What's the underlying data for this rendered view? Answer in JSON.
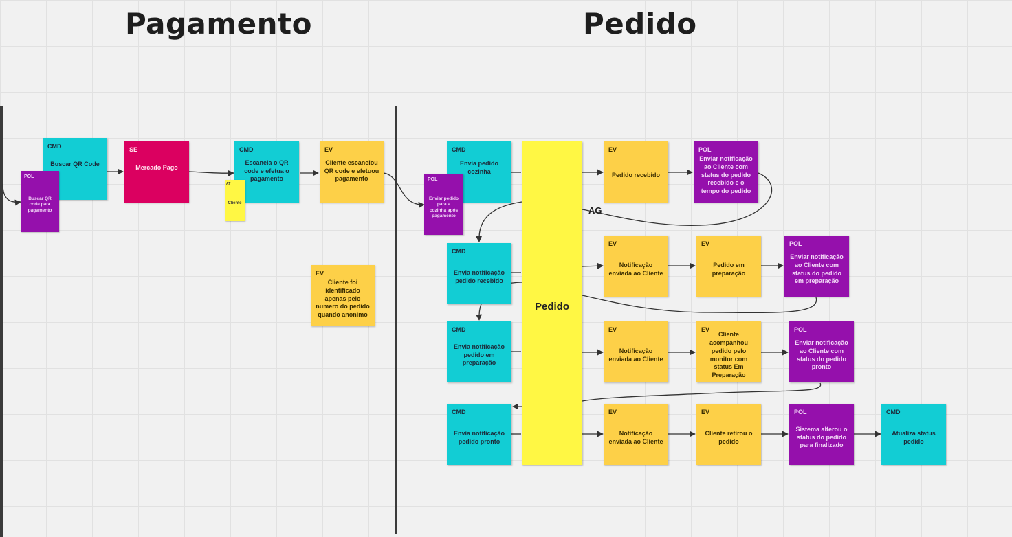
{
  "titles": {
    "left": "Pagamento",
    "right": "Pedido"
  },
  "colors": {
    "cmd": "#12cdd4",
    "ev": "#fdd048",
    "pol": "#9510ac",
    "se": "#db0060",
    "aggregate": "#fff744"
  },
  "aggregate_label": "AG",
  "stickies": {
    "cmd_buscar": {
      "tag": "CMD",
      "text": "Buscar QR Code"
    },
    "pol_buscar": {
      "tag": "POL",
      "text": "Buscar QR code para pagamento"
    },
    "se_mercado": {
      "tag": "SE",
      "text": "Mercado Pago"
    },
    "cmd_escaneia": {
      "tag": "CMD",
      "text": "Escaneia o QR code e efetua o pagamento"
    },
    "at_cliente": {
      "tag": "AT",
      "text": "Cliente"
    },
    "ev_escaneou": {
      "tag": "EV",
      "text": "Cliente escaneiou QR code e efetuou pagamento"
    },
    "ev_identificado": {
      "tag": "EV",
      "text": "Cliente foi identificado apenas pelo numero do pedido quando anonimo"
    },
    "cmd_envia_cozinha": {
      "tag": "CMD",
      "text": "Envia pedido cozinha"
    },
    "pol_enviar_cozinha": {
      "tag": "POL",
      "text": "Enviar pedido para a cozinha após pagamento"
    },
    "agg_pedido": {
      "text": "Pedido"
    },
    "ev_recebido": {
      "tag": "EV",
      "text": "Pedido recebido"
    },
    "pol_notif_recebido": {
      "tag": "POL",
      "text": "Enviar notificação ao Cliente com status do pedido recebido e o tempo do pedido"
    },
    "cmd_notif_recebido": {
      "tag": "CMD",
      "text": "Envia notificação pedido recebido"
    },
    "ev_notif_enviada_1": {
      "tag": "EV",
      "text": "Notificação enviada ao Cliente"
    },
    "ev_em_preparacao": {
      "tag": "EV",
      "text": "Pedido em preparação"
    },
    "pol_notif_preparacao": {
      "tag": "POL",
      "text": "Enviar notificação ao Cliente com status do pedido em preparação"
    },
    "cmd_notif_preparacao": {
      "tag": "CMD",
      "text": "Envia notificação pedido em preparação"
    },
    "ev_notif_enviada_2": {
      "tag": "EV",
      "text": "Notificação enviada ao Cliente"
    },
    "ev_acompanhou": {
      "tag": "EV",
      "text": "Cliente acompanhou pedido pelo monitor com status Em Preparação"
    },
    "pol_notif_pronto": {
      "tag": "POL",
      "text": "Enviar notificação ao Cliente com status do pedido pronto"
    },
    "cmd_notif_pronto": {
      "tag": "CMD",
      "text": "Envia notificação pedido pronto"
    },
    "ev_notif_enviada_3": {
      "tag": "EV",
      "text": "Notificação enviada ao Cliente"
    },
    "ev_retirou": {
      "tag": "EV",
      "text": "Cliente retirou o pedido"
    },
    "pol_finalizado": {
      "tag": "POL",
      "text": "Sistema alterou o status do pedido para finalizado"
    },
    "cmd_atualiza": {
      "tag": "CMD",
      "text": "Atualiza status pedido"
    }
  }
}
